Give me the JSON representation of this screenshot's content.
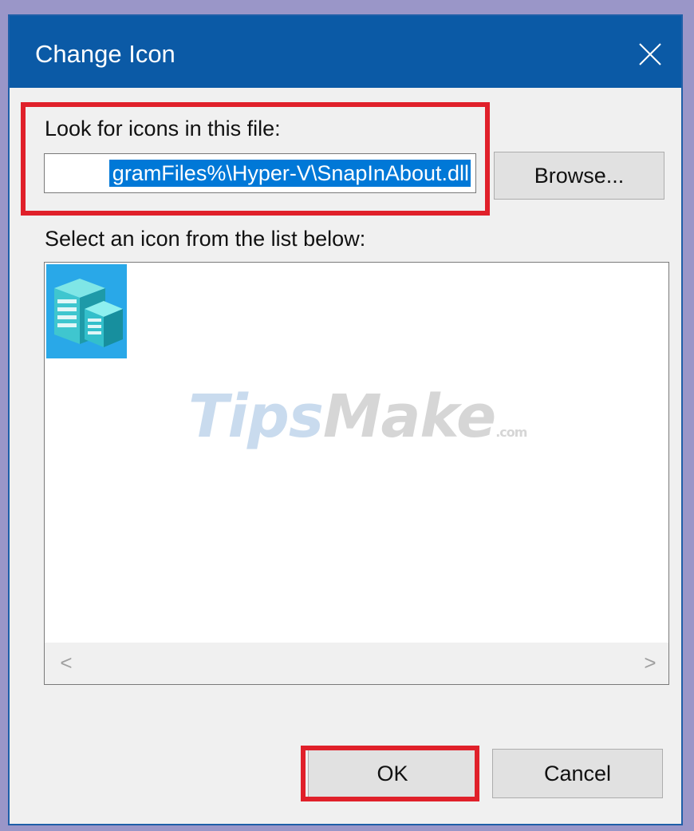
{
  "dialog": {
    "title": "Change Icon",
    "close_icon": "close-icon"
  },
  "file_section": {
    "label": "Look for icons in this file:",
    "path_value": "gramFiles%\\Hyper-V\\SnapInAbout.dll",
    "browse_label": "Browse..."
  },
  "icon_section": {
    "label": "Select an icon from the list below:",
    "icons": [
      {
        "name": "server-icon",
        "selected": true
      }
    ],
    "scroll_left": "<",
    "scroll_right": ">"
  },
  "watermark": {
    "part1": "Tips",
    "part2": "Make",
    "part3": ".com"
  },
  "actions": {
    "ok_label": "OK",
    "cancel_label": "Cancel"
  },
  "colors": {
    "titlebar": "#0b5aa6",
    "selection": "#0078d7",
    "highlight": "#e0202a"
  }
}
